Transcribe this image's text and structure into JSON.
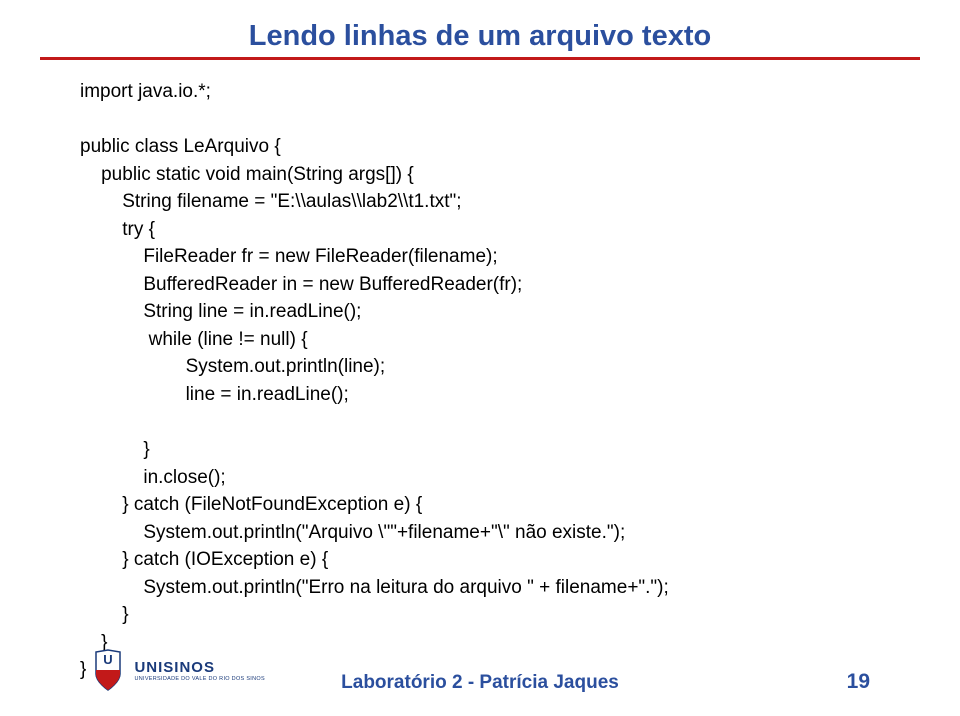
{
  "title": "Lendo linhas de um arquivo texto",
  "code": {
    "l01": "import java.io.*;",
    "l02": "",
    "l03": "public class LeArquivo {",
    "l04": "    public static void main(String args[]) {",
    "l05": "        String filename = \"E:\\\\aulas\\\\lab2\\\\t1.txt\";",
    "l06": "        try {",
    "l07": "            FileReader fr = new FileReader(filename);",
    "l08": "            BufferedReader in = new BufferedReader(fr);",
    "l09": "            String line = in.readLine();",
    "l10": "             while (line != null) {",
    "l11": "                    System.out.println(line);",
    "l12": "                    line = in.readLine();",
    "l13": "",
    "l14": "            }",
    "l15": "            in.close();",
    "l16": "        } catch (FileNotFoundException e) {",
    "l17": "            System.out.println(\"Arquivo \\\"\"+filename+\"\\\" não existe.\");",
    "l18": "        } catch (IOException e) {",
    "l19": "            System.out.println(\"Erro na leitura do arquivo \" + filename+\".\");",
    "l20": "        }",
    "l21": "    }",
    "l22": "}"
  },
  "footer": "Laboratório 2 - Patrícia Jaques",
  "page": "19",
  "logo": {
    "name": "UNISINOS",
    "sub": "UNIVERSIDADE DO VALE DO RIO DOS SINOS"
  }
}
